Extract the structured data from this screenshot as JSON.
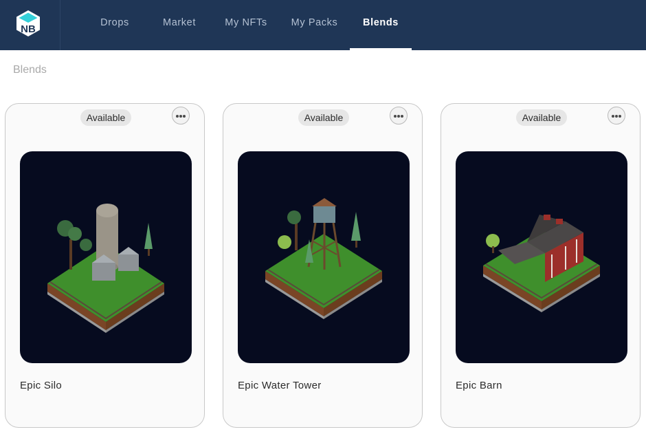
{
  "nav": {
    "logo_text": "NB",
    "items": [
      {
        "label": "Drops",
        "active": false
      },
      {
        "label": "Market",
        "active": false
      },
      {
        "label": "My NFTs",
        "active": false
      },
      {
        "label": "My Packs",
        "active": false
      },
      {
        "label": "Blends",
        "active": true
      }
    ]
  },
  "page": {
    "title": "Blends"
  },
  "cards": [
    {
      "status": "Available",
      "title": "Epic Silo",
      "scene": "silo"
    },
    {
      "status": "Available",
      "title": "Epic Water Tower",
      "scene": "water-tower"
    },
    {
      "status": "Available",
      "title": "Epic Barn",
      "scene": "barn"
    }
  ],
  "colors": {
    "nav_bg": "#1f3656",
    "nav_text": "#b4c1d3",
    "active_text": "#ffffff",
    "art_bg": "#060b1f",
    "grass": "#3f8f2c",
    "badge_bg": "#e6e6e6"
  }
}
